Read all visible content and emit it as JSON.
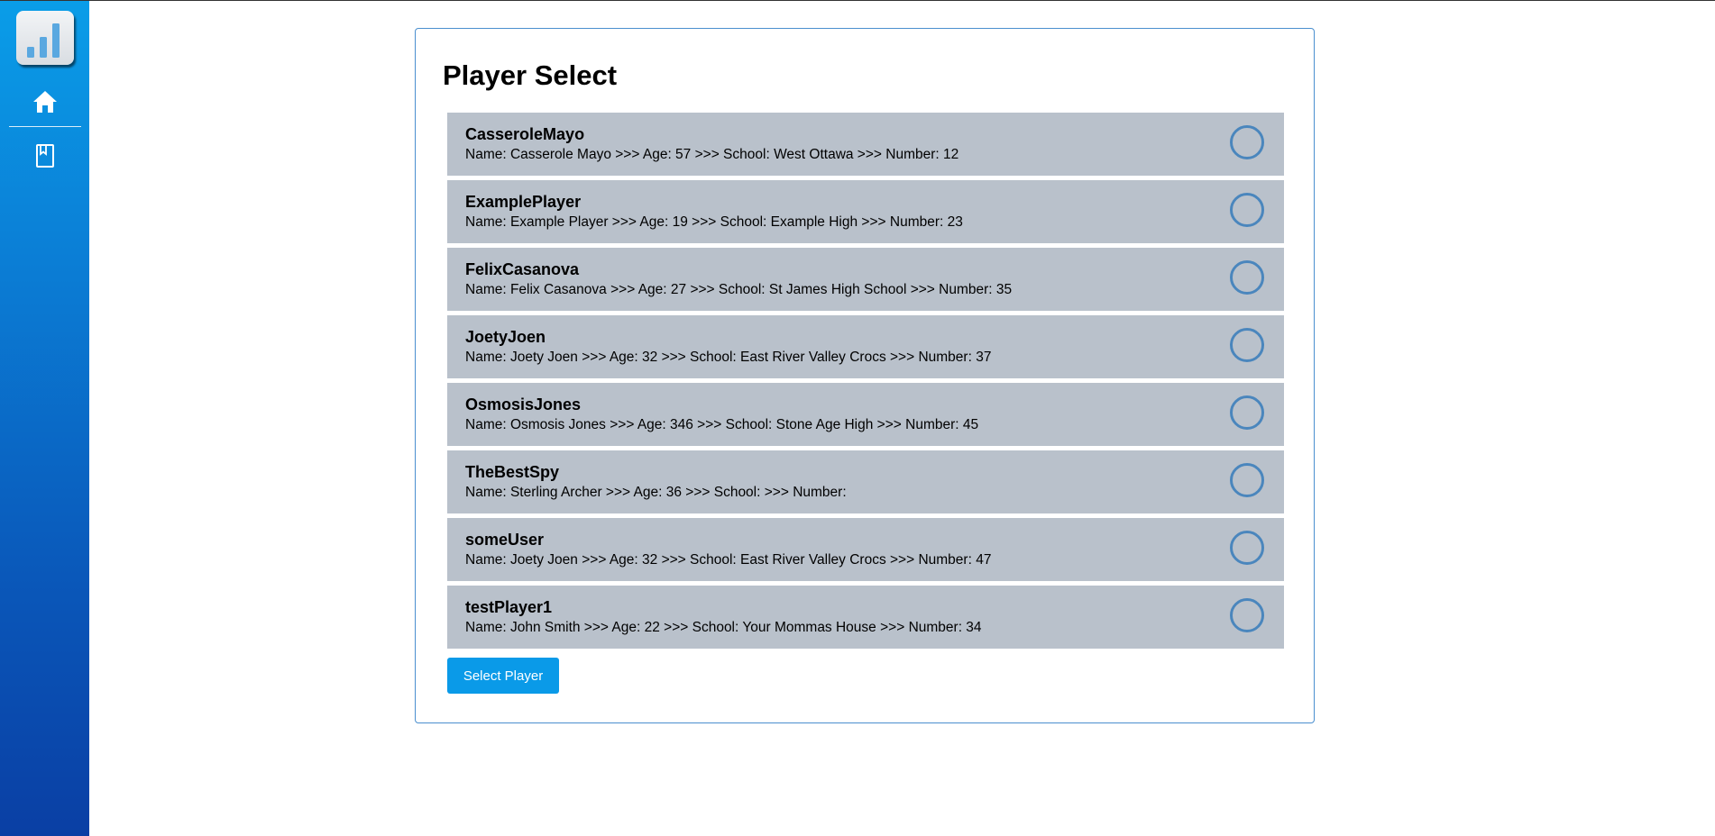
{
  "sidebar": {
    "logo_icon": "bar-chart-icon",
    "nav": [
      {
        "icon": "home-icon"
      },
      {
        "icon": "book-icon"
      }
    ]
  },
  "main": {
    "title": "Player Select",
    "players": [
      {
        "username": "CasseroleMayo",
        "details": "Name: Casserole Mayo >>> Age: 57 >>> School: West Ottawa >>> Number: 12",
        "selected": false
      },
      {
        "username": "ExamplePlayer",
        "details": "Name: Example Player >>> Age: 19 >>> School: Example High >>> Number: 23",
        "selected": false
      },
      {
        "username": "FelixCasanova",
        "details": "Name: Felix Casanova >>> Age: 27 >>> School: St James High School >>> Number: 35",
        "selected": false
      },
      {
        "username": "JoetyJoen",
        "details": "Name: Joety Joen >>> Age: 32 >>> School: East River Valley Crocs >>> Number: 37",
        "selected": false
      },
      {
        "username": "OsmosisJones",
        "details": "Name: Osmosis Jones >>> Age: 346 >>> School: Stone Age High >>> Number: 45",
        "selected": false
      },
      {
        "username": "TheBestSpy",
        "details": "Name: Sterling Archer >>> Age: 36 >>> School: >>> Number:",
        "selected": false
      },
      {
        "username": "someUser",
        "details": "Name: Joety Joen >>> Age: 32 >>> School: East River Valley Crocs >>> Number: 47",
        "selected": false
      },
      {
        "username": "testPlayer1",
        "details": "Name: John Smith >>> Age: 22 >>> School: Your Mommas House >>> Number: 34",
        "selected": false
      }
    ],
    "select_button_label": "Select Player"
  },
  "colors": {
    "accent": "#0a9ae8",
    "row_background": "#b9c1cb",
    "radio_border": "#4a86bd",
    "panel_border": "#4a8fcf"
  }
}
